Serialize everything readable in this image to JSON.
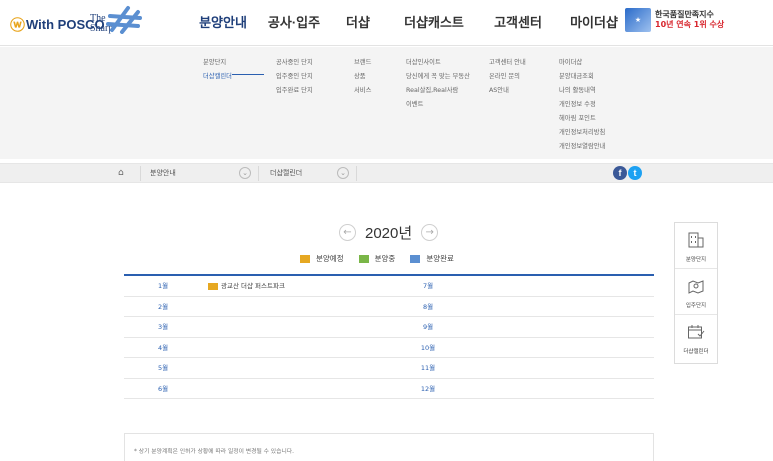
{
  "brand": {
    "posco_logo": "With POSCO",
    "sharp_logo_line1": "The",
    "sharp_logo_line2": "Sharp"
  },
  "gnb": {
    "items": [
      {
        "label": "분양안내"
      },
      {
        "label": "공사·입주"
      },
      {
        "label": "더샵"
      },
      {
        "label": "더샵캐스트"
      },
      {
        "label": "고객센터"
      },
      {
        "label": "마이더샵"
      }
    ],
    "award_line1": "한국품질만족지수",
    "award_line2": "10년 연속 1위 수상"
  },
  "mega": {
    "col1": [
      "분양단지",
      "더샵캘린더"
    ],
    "col2": [
      "공사중인 단지",
      "입주중인 단지",
      "입주완료 단지"
    ],
    "col3": [
      "브랜드",
      "상품",
      "서비스"
    ],
    "col4": [
      "더샵인사이트",
      "당신에게 꼭 맞는 부동산",
      "Real살집,Real사람",
      "이벤트"
    ],
    "col5": [
      "고객센터 안내",
      "온라인 문의",
      "AS안내"
    ],
    "col6": [
      "마이더샵",
      "분양대금조회",
      "나의 활동내역",
      "개인정보 수정",
      "헤아림 포인트",
      "개인정보처리방침",
      "개인정보열람안내"
    ]
  },
  "breadcrumb": {
    "home_icon": "home-icon",
    "level1": "분양안내",
    "level2": "더샵캘린더",
    "sns_facebook": "f",
    "sns_twitter": "t"
  },
  "calendar": {
    "year": "2020년",
    "prev_icon": "←",
    "next_icon": "→",
    "legend": [
      {
        "label": "분양예정",
        "color": "#e6a822"
      },
      {
        "label": "분양중",
        "color": "#7ab648"
      },
      {
        "label": "분양완료",
        "color": "#5b8fd1"
      }
    ],
    "rows": [
      {
        "left_month": "1월",
        "left_event": "광교산 더샵 퍼스트파크",
        "right_month": "7월",
        "right_event": ""
      },
      {
        "left_month": "2월",
        "left_event": "",
        "right_month": "8월",
        "right_event": ""
      },
      {
        "left_month": "3월",
        "left_event": "",
        "right_month": "9월",
        "right_event": ""
      },
      {
        "left_month": "4월",
        "left_event": "",
        "right_month": "10월",
        "right_event": ""
      },
      {
        "left_month": "5월",
        "left_event": "",
        "right_month": "11월",
        "right_event": ""
      },
      {
        "left_month": "6월",
        "left_event": "",
        "right_month": "12월",
        "right_event": ""
      }
    ],
    "note": "* 상기 분양계획은 인허가 상황에 따라 일정이 변경될 수 있습니다."
  },
  "quick_menu": {
    "items": [
      {
        "label": "분양단지",
        "icon": "building-icon"
      },
      {
        "label": "입주단지",
        "icon": "map-icon"
      },
      {
        "label": "더샵캘린더",
        "icon": "calendar-icon"
      }
    ]
  },
  "colors": {
    "accent": "#2a5fb0",
    "brand_navy": "#1f3f7a"
  }
}
